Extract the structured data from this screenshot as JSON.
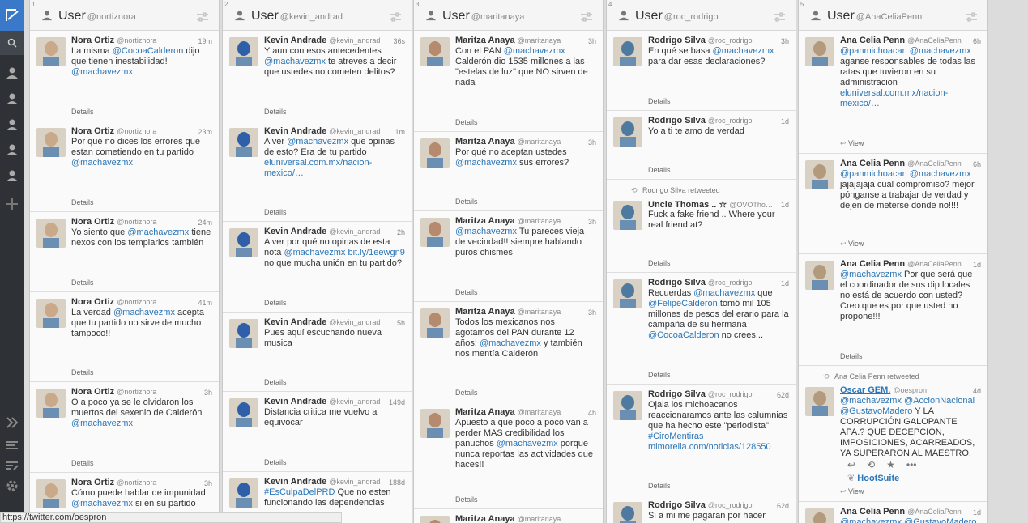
{
  "app": {
    "title": "HootSuite"
  },
  "status_url": "https://twitter.com/oespron",
  "colors": {
    "accent": "#3a79c9",
    "mention": "#2b76b7",
    "sidebar": "#2e3237"
  },
  "columns": [
    {
      "num": "1",
      "title": "User",
      "handle": "@nortiznora",
      "tweets": [
        {
          "name": "Nora Ortiz",
          "handle": "@nortiznora",
          "time": "19m",
          "text": [
            "La misma ",
            {
              "m": "@CocoaCalderon"
            },
            " dijo que tienen inestabilidad! ",
            {
              "m": "@machavezmx"
            }
          ],
          "details": "Details"
        },
        {
          "name": "Nora Ortiz",
          "handle": "@nortiznora",
          "time": "23m",
          "text": [
            "Por qué no dices los errores que estan cometiendo en tu partido ",
            {
              "m": "@machavezmx"
            }
          ],
          "details": "Details"
        },
        {
          "name": "Nora Ortiz",
          "handle": "@nortiznora",
          "time": "24m",
          "text": [
            "Yo siento que ",
            {
              "m": "@machavezmx"
            },
            " tiene nexos con los templarios también"
          ],
          "details": "Details"
        },
        {
          "name": "Nora Ortiz",
          "handle": "@nortiznora",
          "time": "41m",
          "text": [
            "La verdad ",
            {
              "m": "@machavezmx"
            },
            " acepta que tu partido no sirve de mucho tampoco!!"
          ],
          "details": "Details"
        },
        {
          "name": "Nora Ortiz",
          "handle": "@nortiznora",
          "time": "3h",
          "text": [
            "O a poco ya se le olvidaron los muertos del sexenio de Calderón ",
            {
              "m": "@machavezmx"
            }
          ],
          "details": "Details"
        },
        {
          "name": "Nora Ortiz",
          "handle": "@nortiznora",
          "time": "3h",
          "text": [
            "Cómo puede hablar de impunidad ",
            {
              "m": "@machavezmx"
            },
            " si en su partido"
          ],
          "details": ""
        }
      ]
    },
    {
      "num": "2",
      "title": "User",
      "handle": "@kevin_andrad",
      "tweets": [
        {
          "name": "Kevin Andrade",
          "handle": "@kevin_andrad",
          "time": "36s",
          "text": [
            "Y aun con esos antecedentes ",
            {
              "m": "@machavezmx"
            },
            " te atreves a decir que ustedes no cometen delitos?"
          ],
          "details": "Details"
        },
        {
          "name": "Kevin Andrade",
          "handle": "@kevin_andrad",
          "time": "1m",
          "text": [
            "A ver ",
            {
              "m": "@machavezmx"
            },
            " que opinas de esto? Era de tu partido ",
            {
              "m": "eluniversal.com.mx/nacion-mexico/…"
            }
          ],
          "details": "Details"
        },
        {
          "name": "Kevin Andrade",
          "handle": "@kevin_andrad",
          "time": "2h",
          "text": [
            "A ver por qué no opinas de esta nota ",
            {
              "m": "@machavezmx"
            },
            " ",
            {
              "m": "bit.ly/1eewgn9"
            },
            " no que mucha unión en tu partido?"
          ],
          "details": "Details"
        },
        {
          "name": "Kevin Andrade",
          "handle": "@kevin_andrad",
          "time": "5h",
          "text": [
            "Pues aquí escuchando nueva musica"
          ],
          "details": "Details"
        },
        {
          "name": "Kevin Andrade",
          "handle": "@kevin_andrad",
          "time": "149d",
          "text": [
            "Distancia critica me vuelvo a equivocar"
          ],
          "details": "Details"
        },
        {
          "name": "Kevin Andrade",
          "handle": "@kevin_andrad",
          "time": "188d",
          "text": [
            {
              "m": "#EsCulpaDelPRD"
            },
            " Que no esten funcionando las dependencias"
          ],
          "details": ""
        }
      ]
    },
    {
      "num": "3",
      "title": "User",
      "handle": "@maritanaya",
      "tweets": [
        {
          "name": "Maritza Anaya",
          "handle": "@maritanaya",
          "time": "3h",
          "text": [
            "Con el PAN ",
            {
              "m": "@machavezmx"
            },
            " Calderón dio 1535 millones a las \"estelas de luz\" que NO sirven de nada"
          ],
          "details": "Details"
        },
        {
          "name": "Maritza Anaya",
          "handle": "@maritanaya",
          "time": "3h",
          "text": [
            "Por qué no aceptan ustedes ",
            {
              "m": "@machavezmx"
            },
            " sus errores?"
          ],
          "details": "Details"
        },
        {
          "name": "Maritza Anaya",
          "handle": "@maritanaya",
          "time": "3h",
          "text": [
            {
              "m": "@machavezmx"
            },
            " Tu pareces vieja de vecindad!! siempre hablando puros chismes"
          ],
          "details": "Details"
        },
        {
          "name": "Maritza Anaya",
          "handle": "@maritanaya",
          "time": "3h",
          "text": [
            "Todos los mexicanos nos agotamos del PAN durante 12 años! ",
            {
              "m": "@machavezmx"
            },
            " y también nos mentía Calderón"
          ],
          "details": "Details"
        },
        {
          "name": "Maritza Anaya",
          "handle": "@maritanaya",
          "time": "4h",
          "text": [
            "Apuesto a que poco a poco van a perder MAS credibilidad los panuchos ",
            {
              "m": "@machavezmx"
            },
            " porque nunca reportas las actividades que haces!!"
          ],
          "details": "Details"
        },
        {
          "name": "Maritza Anaya",
          "handle": "@maritanaya",
          "time": "",
          "text": [
            ""
          ],
          "details": ""
        }
      ]
    },
    {
      "num": "4",
      "title": "User",
      "handle": "@roc_rodrigo",
      "tweets": [
        {
          "name": "Rodrigo Silva",
          "handle": "@roc_rodrigo",
          "time": "3h",
          "text": [
            "En qué se basa ",
            {
              "m": "@machavezmx"
            },
            " para dar esas declaraciones?"
          ],
          "details": "Details"
        },
        {
          "name": "Rodrigo Silva",
          "handle": "@roc_rodrigo",
          "time": "1d",
          "text": [
            "Yo a ti te amo de verdad"
          ],
          "details": "Details"
        },
        {
          "rt": "Rodrigo Silva retweeted",
          "name": "Uncle Thomas .. ☆",
          "handle": "@OVOTho…",
          "time": "1d",
          "text": [
            "Fuck a fake friend .. Where your real friend at?"
          ],
          "details": "Details"
        },
        {
          "name": "Rodrigo Silva",
          "handle": "@roc_rodrigo",
          "time": "1d",
          "text": [
            "Recuerdas ",
            {
              "m": "@machavezmx"
            },
            " que ",
            {
              "m": "@FelipeCalderon"
            },
            " tomó mil 105 millones de pesos del erario para la campaña de su hermana ",
            {
              "m": "@CocoaCalderon"
            },
            " no crees..."
          ],
          "details": "Details"
        },
        {
          "name": "Rodrigo Silva",
          "handle": "@roc_rodrigo",
          "time": "62d",
          "text": [
            "Ojala los michoacanos reaccionaramos ante las calumnias que ha hecho este \"periodista\" ",
            {
              "m": "#CiroMentiras"
            },
            " ",
            {
              "m": "mimorelia.com/noticias/128550"
            }
          ],
          "details": "Details"
        },
        {
          "name": "Rodrigo Silva",
          "handle": "@roc_rodrigo",
          "time": "62d",
          "text": [
            "Si a mi me pagaran por hacer"
          ],
          "details": ""
        }
      ]
    },
    {
      "num": "5",
      "title": "User",
      "handle": "@AnaCeliaPenn",
      "tweets": [
        {
          "name": "Ana Celia Penn",
          "handle": "@AnaCeliaPenn",
          "time": "6h",
          "text": [
            {
              "m": "@panmichoacan"
            },
            " ",
            {
              "m": "@machavezmx"
            },
            " aganse responsables de todas las ratas que tuvieron en su administracion ",
            {
              "m": "eluniversal.com.mx/nacion-mexico/…"
            }
          ],
          "details": "View"
        },
        {
          "name": "Ana Celia Penn",
          "handle": "@AnaCeliaPenn",
          "time": "6h",
          "text": [
            {
              "m": "@panmichoacan"
            },
            " ",
            {
              "m": "@machavezmx"
            },
            " jajajajaja cual compromiso? mejor pónganse a trabajar de verdad y dejen de meterse donde no!!!!"
          ],
          "details": "View"
        },
        {
          "name": "Ana Celia Penn",
          "handle": "@AnaCeliaPenn",
          "time": "1d",
          "text": [
            {
              "m": "@machavezmx"
            },
            " Por que será que el coordinador de sus dip locales no está de acuerdo con usted? Creo que es por que usted no propone!!!"
          ],
          "details": "Details"
        },
        {
          "rt": "Ana Celia Penn retweeted",
          "name": "Oscar GEM.",
          "handle": "@oespron",
          "time": "4d",
          "text": [
            {
              "m": "@machavezmx"
            },
            " ",
            {
              "m": "@AccionNacional"
            },
            " ",
            {
              "m": "@GustavoMadero"
            },
            " Y LA CORRUPCIÓN GALOPANTE APA.? QUE DECEPCIÓN, IMPOSICIONES, ACARREADOS, YA SUPERARON AL MAESTRO."
          ],
          "details": "View",
          "source": "HootSuite"
        },
        {
          "name": "Ana Celia Penn",
          "handle": "@AnaCeliaPenn",
          "time": "1d",
          "text": [
            {
              "m": "@machavezmx"
            },
            " ",
            {
              "m": "@GustavoMadero"
            }
          ],
          "details": ""
        }
      ]
    }
  ]
}
